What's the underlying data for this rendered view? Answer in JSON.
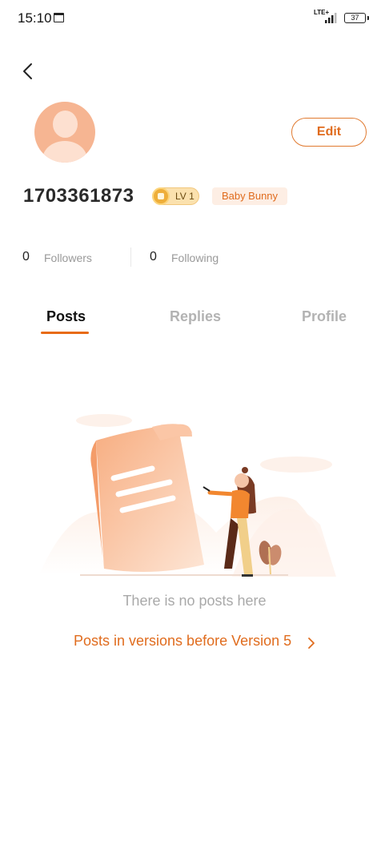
{
  "status_bar": {
    "time": "15:10",
    "network": "LTE+",
    "battery": "37",
    "icons": [
      "calendar-icon",
      "signal-icon",
      "battery-icon"
    ]
  },
  "header": {
    "back_icon": "chevron-left-icon"
  },
  "profile": {
    "avatar_icon": "default-avatar-icon",
    "edit_label": "Edit",
    "user_id": "1703361873",
    "level_label": "LV 1",
    "title_badge": "Baby Bunny",
    "followers_count": "0",
    "followers_label": "Followers",
    "following_count": "0",
    "following_label": "Following"
  },
  "tabs": [
    {
      "label": "Posts",
      "active": true
    },
    {
      "label": "Replies",
      "active": false
    },
    {
      "label": "Profile",
      "active": false
    }
  ],
  "empty_state": {
    "illustration": "woman-writing-on-scroll-illustration",
    "message": "There is no posts here",
    "link_text": "Posts in versions before Version 5",
    "link_icon": "chevron-right-icon"
  },
  "colors": {
    "accent": "#e06c1e",
    "tab_active": "#111111",
    "tab_inactive": "#b3b3b3",
    "level_badge": "#fbe1ae",
    "title_badge_bg": "#fdeee4",
    "avatar": "#f6b592"
  }
}
